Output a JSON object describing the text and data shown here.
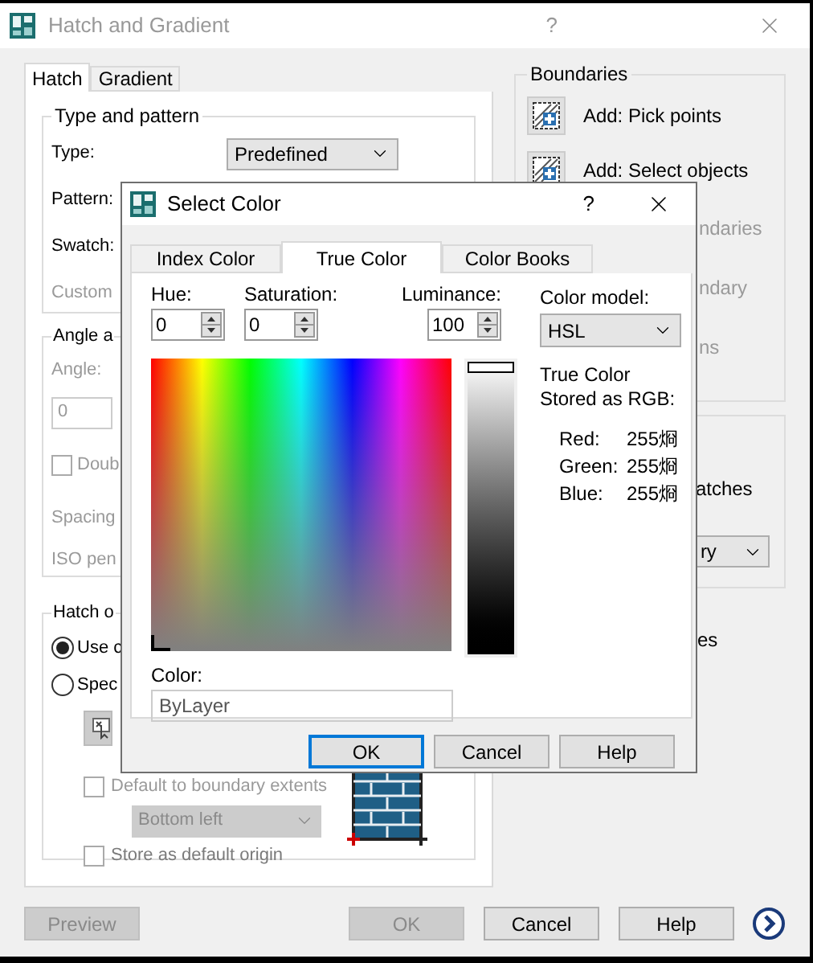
{
  "window": {
    "title": "Hatch and Gradient",
    "help_label": "?"
  },
  "tabs": [
    {
      "label": "Hatch",
      "selected": true
    },
    {
      "label": "Gradient",
      "selected": false
    }
  ],
  "type_and_pattern": {
    "title": "Type and pattern",
    "rows": [
      {
        "kind": "select",
        "label": "Type:",
        "value": "Predefined",
        "disabled": false
      },
      {
        "kind": "label",
        "label": "Pattern:",
        "disabled": false
      },
      {
        "kind": "label",
        "label": "Swatch:",
        "disabled": false
      },
      {
        "kind": "label",
        "label": "Custom",
        "disabled": true
      }
    ]
  },
  "angle_and_scale": {
    "title": "Angle a",
    "rows": [
      {
        "kind": "label",
        "label": "Angle:",
        "disabled": true
      },
      {
        "kind": "field",
        "value": "0",
        "disabled": true
      },
      {
        "kind": "checkbox",
        "label": "Doub",
        "checked": false,
        "disabled": true
      },
      {
        "kind": "label",
        "label": "Spacing",
        "disabled": true
      },
      {
        "kind": "label",
        "label": "ISO pen",
        "disabled": true
      }
    ]
  },
  "hatch_origin": {
    "title": "Hatch o",
    "options": [
      {
        "label": "Use c",
        "selected": true
      },
      {
        "label": "Spec",
        "selected": false
      }
    ],
    "default_extents": {
      "label": "Default to boundary extents",
      "checked": false
    },
    "position": {
      "value": "Bottom left"
    },
    "store_default": {
      "label": "Store as default origin",
      "checked": false
    }
  },
  "boundaries": {
    "title": "Boundaries",
    "items": [
      {
        "label": "Add: Pick points",
        "kind": "full"
      },
      {
        "label": "Add: Select objects",
        "kind": "full"
      },
      {
        "label": "ndaries",
        "kind": "cut"
      },
      {
        "label": "ndary",
        "kind": "cut"
      },
      {
        "label": "ns",
        "kind": "cut"
      }
    ]
  },
  "options": {
    "label": "atches",
    "dropdown_value": "ry"
  },
  "after_options": {
    "label": "es"
  },
  "footer_buttons": [
    {
      "label": "Preview",
      "disabled": true
    },
    {
      "label": "OK",
      "disabled": true
    },
    {
      "label": "Cancel",
      "disabled": false
    },
    {
      "label": "Help",
      "disabled": false
    }
  ],
  "dialog": {
    "title": "Select Color",
    "help_label": "?",
    "tabs": [
      {
        "label": "Index Color",
        "selected": false
      },
      {
        "label": "True Color",
        "selected": true
      },
      {
        "label": "Color Books",
        "selected": false
      }
    ],
    "hue": {
      "label": "Hue:",
      "value": "0"
    },
    "saturation": {
      "label": "Saturation:",
      "value": "0"
    },
    "luminance": {
      "label": "Luminance:",
      "value": "100",
      "level": 1
    },
    "color_model": {
      "label": "Color model:",
      "value": "HSL"
    },
    "stored_label": "True Color Stored as RGB:",
    "rgb": [
      {
        "label": "Red:",
        "value": "255烱"
      },
      {
        "label": "Green:",
        "value": "255烱"
      },
      {
        "label": "Blue:",
        "value": "255烱"
      }
    ],
    "color": {
      "label": "Color:",
      "value": "ByLayer"
    },
    "buttons": [
      {
        "label": "OK",
        "focused": true
      },
      {
        "label": "Cancel",
        "focused": false
      },
      {
        "label": "Help",
        "focused": false
      }
    ]
  }
}
